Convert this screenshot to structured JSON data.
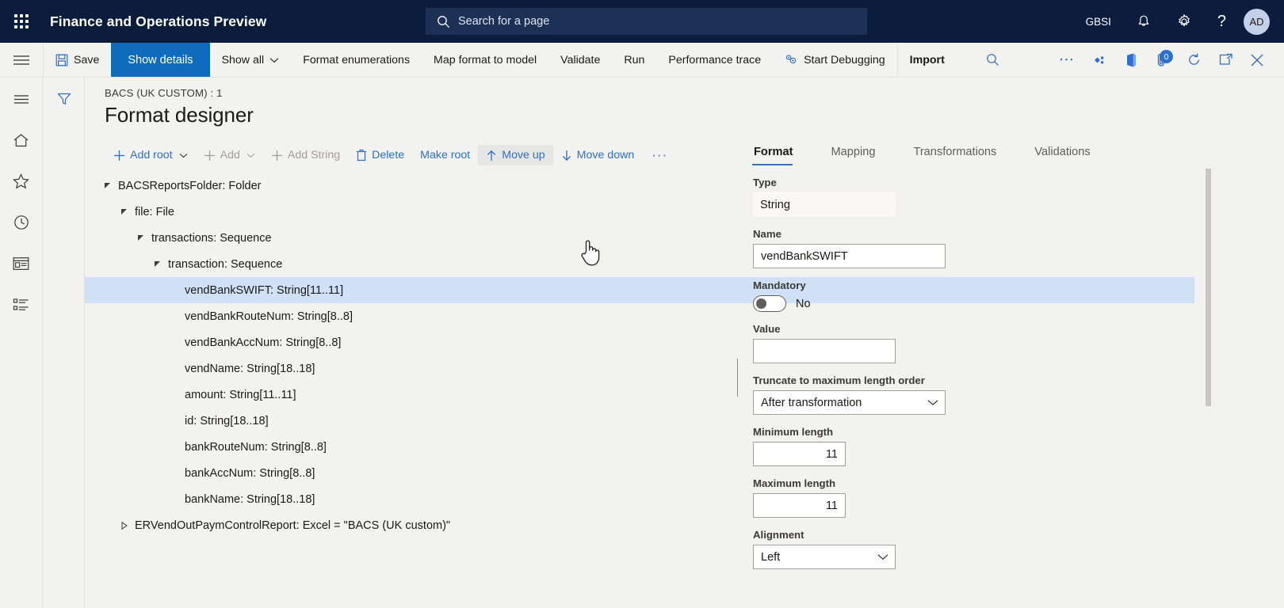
{
  "topbar": {
    "waffle_icon": "waffle-grid-icon",
    "app_title": "Finance and Operations Preview",
    "search": {
      "placeholder": "Search for a page",
      "value": "",
      "icon": "search-icon"
    },
    "company": "GBSI",
    "notifications_icon": "bell-icon",
    "settings_icon": "gear-icon",
    "help_icon": "question-mark-icon",
    "avatar_initials": "AD"
  },
  "actionpane": {
    "hamburger_icon": "hamburger-menu-icon",
    "save_label": "Save",
    "save_icon": "save-disk-icon",
    "show_details_label": "Show details",
    "show_all_label": "Show all",
    "show_all_chevron": "chevron-down-icon",
    "format_enumerations_label": "Format enumerations",
    "map_format_to_model_label": "Map format to model",
    "validate_label": "Validate",
    "run_label": "Run",
    "performance_trace_label": "Performance trace",
    "start_debugging_label": "Start Debugging",
    "start_debugging_icon": "debug-gears-icon",
    "import_label": "Import",
    "search_icon": "search-icon",
    "overflow_icon": "ellipsis-icon",
    "share_icon": "share-diamond-icon",
    "office_icon": "office-app-icon",
    "attachments_icon": "attachment-icon",
    "attachments_badge": "0",
    "refresh_icon": "refresh-icon",
    "popout_icon": "open-in-new-window-icon",
    "close_icon": "close-x-icon"
  },
  "rail": {
    "items": [
      {
        "name": "navigation-menu",
        "icon": "hamburger-menu-icon"
      },
      {
        "name": "home",
        "icon": "home-icon"
      },
      {
        "name": "favorites",
        "icon": "star-icon"
      },
      {
        "name": "recent",
        "icon": "clock-icon"
      },
      {
        "name": "workspaces",
        "icon": "workspace-icon"
      },
      {
        "name": "modules",
        "icon": "list-icon"
      }
    ]
  },
  "filter_column": {
    "filter_icon": "filter-funnel-icon"
  },
  "page": {
    "breadcrumb": "BACS (UK CUSTOM) : 1",
    "title": "Format designer"
  },
  "tree_toolbar": {
    "add_root_label": "Add root",
    "add_root_icon": "plus-icon",
    "add_root_chevron": "chevron-down-icon",
    "add_label": "Add",
    "add_icon": "plus-icon",
    "add_chevron": "chevron-down-icon",
    "add_string_label": "Add String",
    "add_string_icon": "plus-icon",
    "delete_label": "Delete",
    "delete_icon": "trash-bin-icon",
    "make_root_label": "Make root",
    "move_up_label": "Move up",
    "move_up_icon": "arrow-up-icon",
    "move_down_label": "Move down",
    "move_down_icon": "arrow-down-icon",
    "overflow_label": "···"
  },
  "tree": {
    "nodes": [
      {
        "label": "BACSReportsFolder: Folder",
        "indent": 0,
        "twist": "expanded",
        "selected": false
      },
      {
        "label": "file: File",
        "indent": 1,
        "twist": "expanded",
        "selected": false
      },
      {
        "label": "transactions: Sequence",
        "indent": 2,
        "twist": "expanded",
        "selected": false
      },
      {
        "label": "transaction: Sequence",
        "indent": 3,
        "twist": "expanded",
        "selected": false
      },
      {
        "label": "vendBankSWIFT: String[11..11]",
        "indent": 4,
        "twist": "none",
        "selected": true
      },
      {
        "label": "vendBankRouteNum: String[8..8]",
        "indent": 4,
        "twist": "none",
        "selected": false
      },
      {
        "label": "vendBankAccNum: String[8..8]",
        "indent": 4,
        "twist": "none",
        "selected": false
      },
      {
        "label": "vendName: String[18..18]",
        "indent": 4,
        "twist": "none",
        "selected": false
      },
      {
        "label": "amount: String[11..11]",
        "indent": 4,
        "twist": "none",
        "selected": false
      },
      {
        "label": "id: String[18..18]",
        "indent": 4,
        "twist": "none",
        "selected": false
      },
      {
        "label": "bankRouteNum: String[8..8]",
        "indent": 4,
        "twist": "none",
        "selected": false
      },
      {
        "label": "bankAccNum: String[8..8]",
        "indent": 4,
        "twist": "none",
        "selected": false
      },
      {
        "label": "bankName: String[18..18]",
        "indent": 4,
        "twist": "none",
        "selected": false
      },
      {
        "label": "ERVendOutPaymControlReport: Excel = \"BACS (UK custom)\"",
        "indent": 1,
        "twist": "collapsed",
        "selected": false
      }
    ]
  },
  "properties": {
    "tabs": [
      {
        "label": "Format",
        "active": true
      },
      {
        "label": "Mapping",
        "active": false
      },
      {
        "label": "Transformations",
        "active": false
      },
      {
        "label": "Validations",
        "active": false
      }
    ],
    "type_label": "Type",
    "type_value": "String",
    "name_label": "Name",
    "name_value": "vendBankSWIFT",
    "mandatory_label": "Mandatory",
    "mandatory_value": "No",
    "value_label": "Value",
    "value_value": "",
    "truncate_label": "Truncate to maximum length order",
    "truncate_value": "After transformation",
    "min_length_label": "Minimum length",
    "min_length_value": "11",
    "max_length_label": "Maximum length",
    "max_length_value": "11",
    "alignment_label": "Alignment",
    "alignment_value": "Left",
    "dropdown_icon": "chevron-down-icon"
  },
  "colors": {
    "nav_bg": "#0b1c3d",
    "accent": "#0f6cbd",
    "link": "#2f6fd0",
    "selection": "#cfe0f7",
    "page_bg": "#f2f2f1"
  }
}
